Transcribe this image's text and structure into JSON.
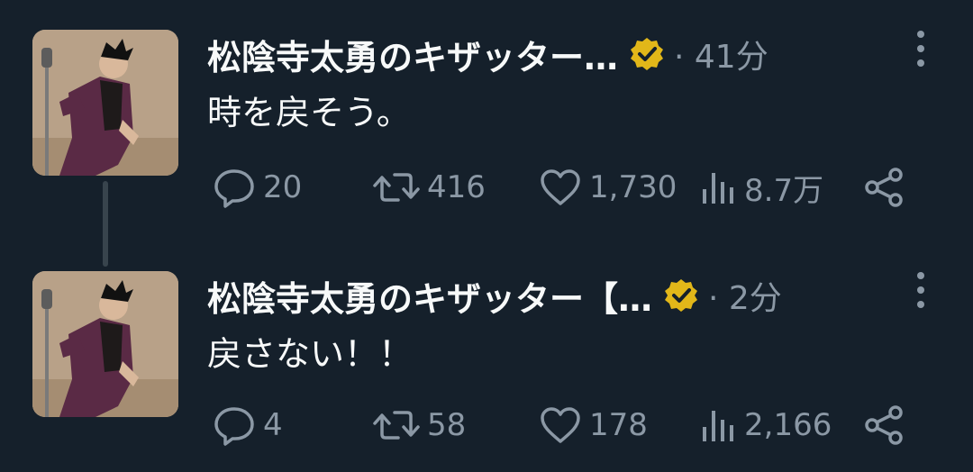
{
  "colors": {
    "background": "#15202b",
    "text_primary": "#f7f9f9",
    "text_secondary": "#8b98a5",
    "verified_badge": "#e2b719",
    "thread_line": "#38444d"
  },
  "tweets": [
    {
      "author_name": "松陰寺太勇のキザッター…",
      "verified_icon": "verified-gold-badge-icon",
      "meta": "· 41分",
      "text": "時を戻そう。",
      "replies": "20",
      "retweets": "416",
      "likes": "1,730",
      "views": "8.7万"
    },
    {
      "author_name": "松陰寺太勇のキザッター【…",
      "verified_icon": "verified-gold-badge-icon",
      "meta": "· 2分",
      "text": "戻さない！！",
      "replies": "4",
      "retweets": "58",
      "likes": "178",
      "views": "2,166"
    }
  ]
}
